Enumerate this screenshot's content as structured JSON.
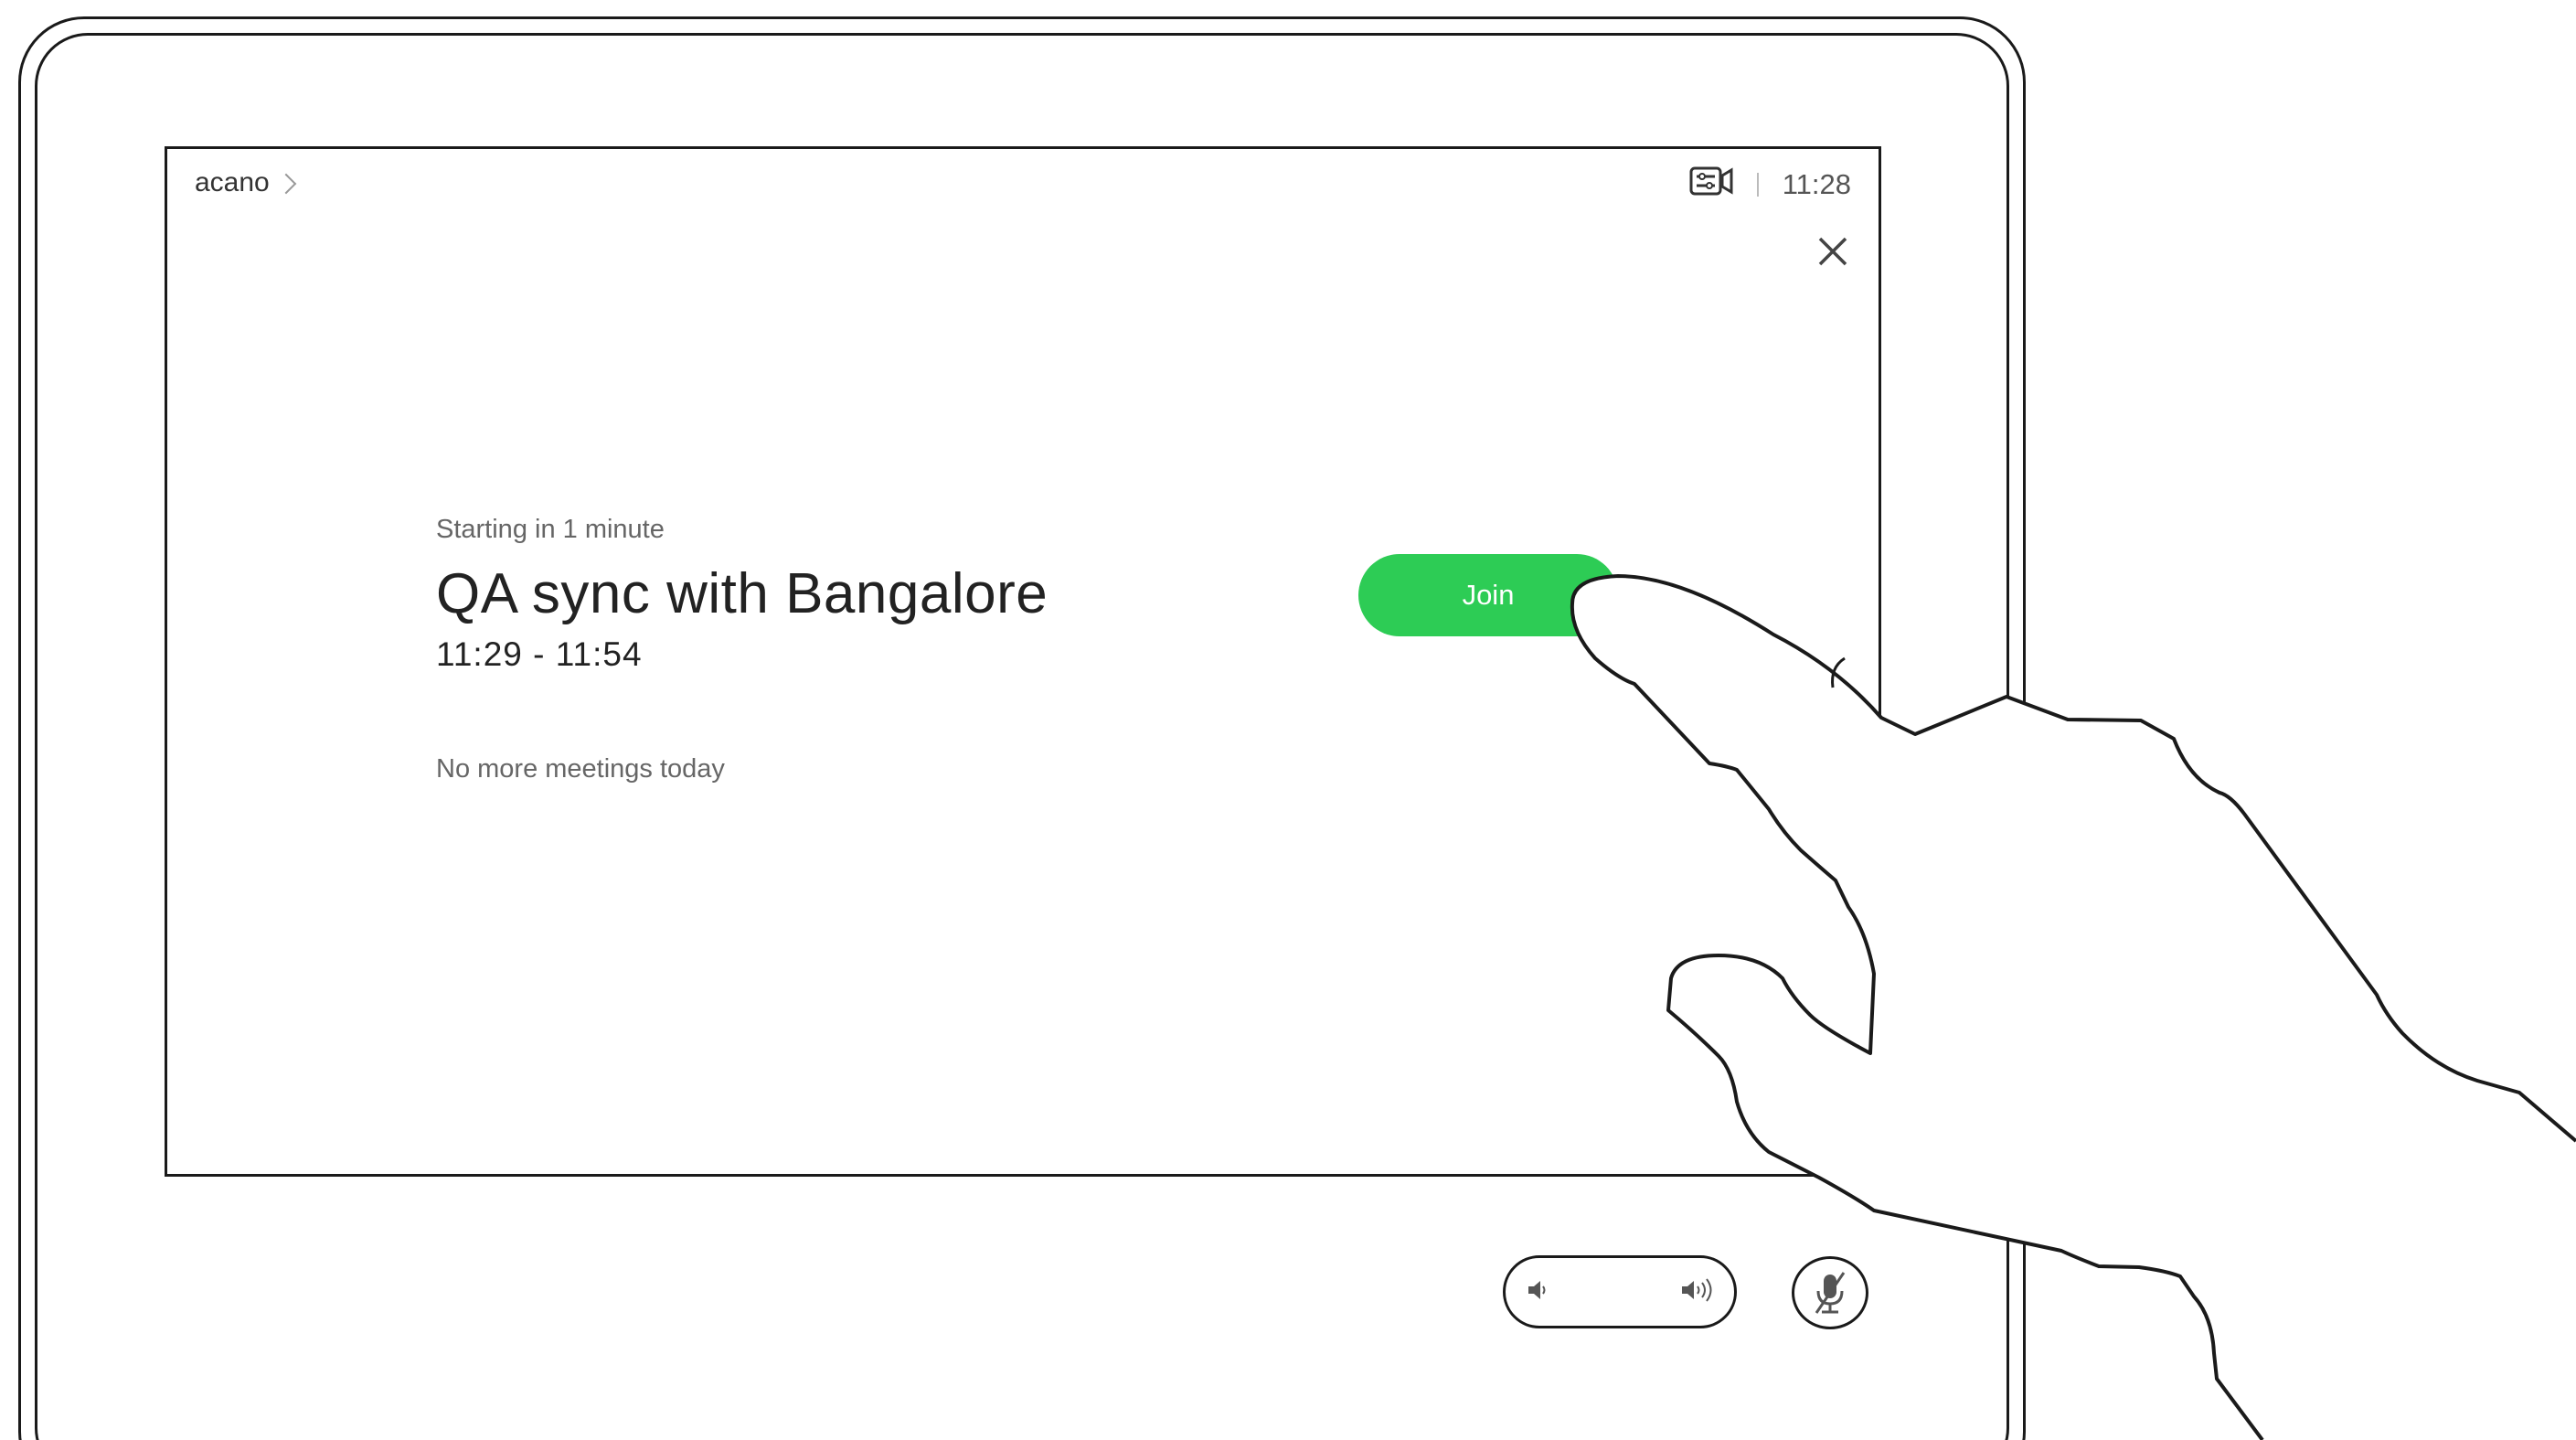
{
  "header": {
    "breadcrumb": "acano",
    "clock": "11:28"
  },
  "meeting": {
    "status": "Starting in 1 minute",
    "title": "QA sync with Bangalore",
    "time_range": "11:29 - 11:54"
  },
  "footer_note": "No more meetings today",
  "actions": {
    "join_label": "Join"
  },
  "icons": {
    "camera": "camera-settings-icon",
    "close": "close-icon",
    "volume_down": "volume-down-icon",
    "volume_up": "volume-up-icon",
    "mic_mute": "microphone-muted-icon"
  },
  "colors": {
    "join": "#2dcc55",
    "outline": "#1a1a1a"
  }
}
